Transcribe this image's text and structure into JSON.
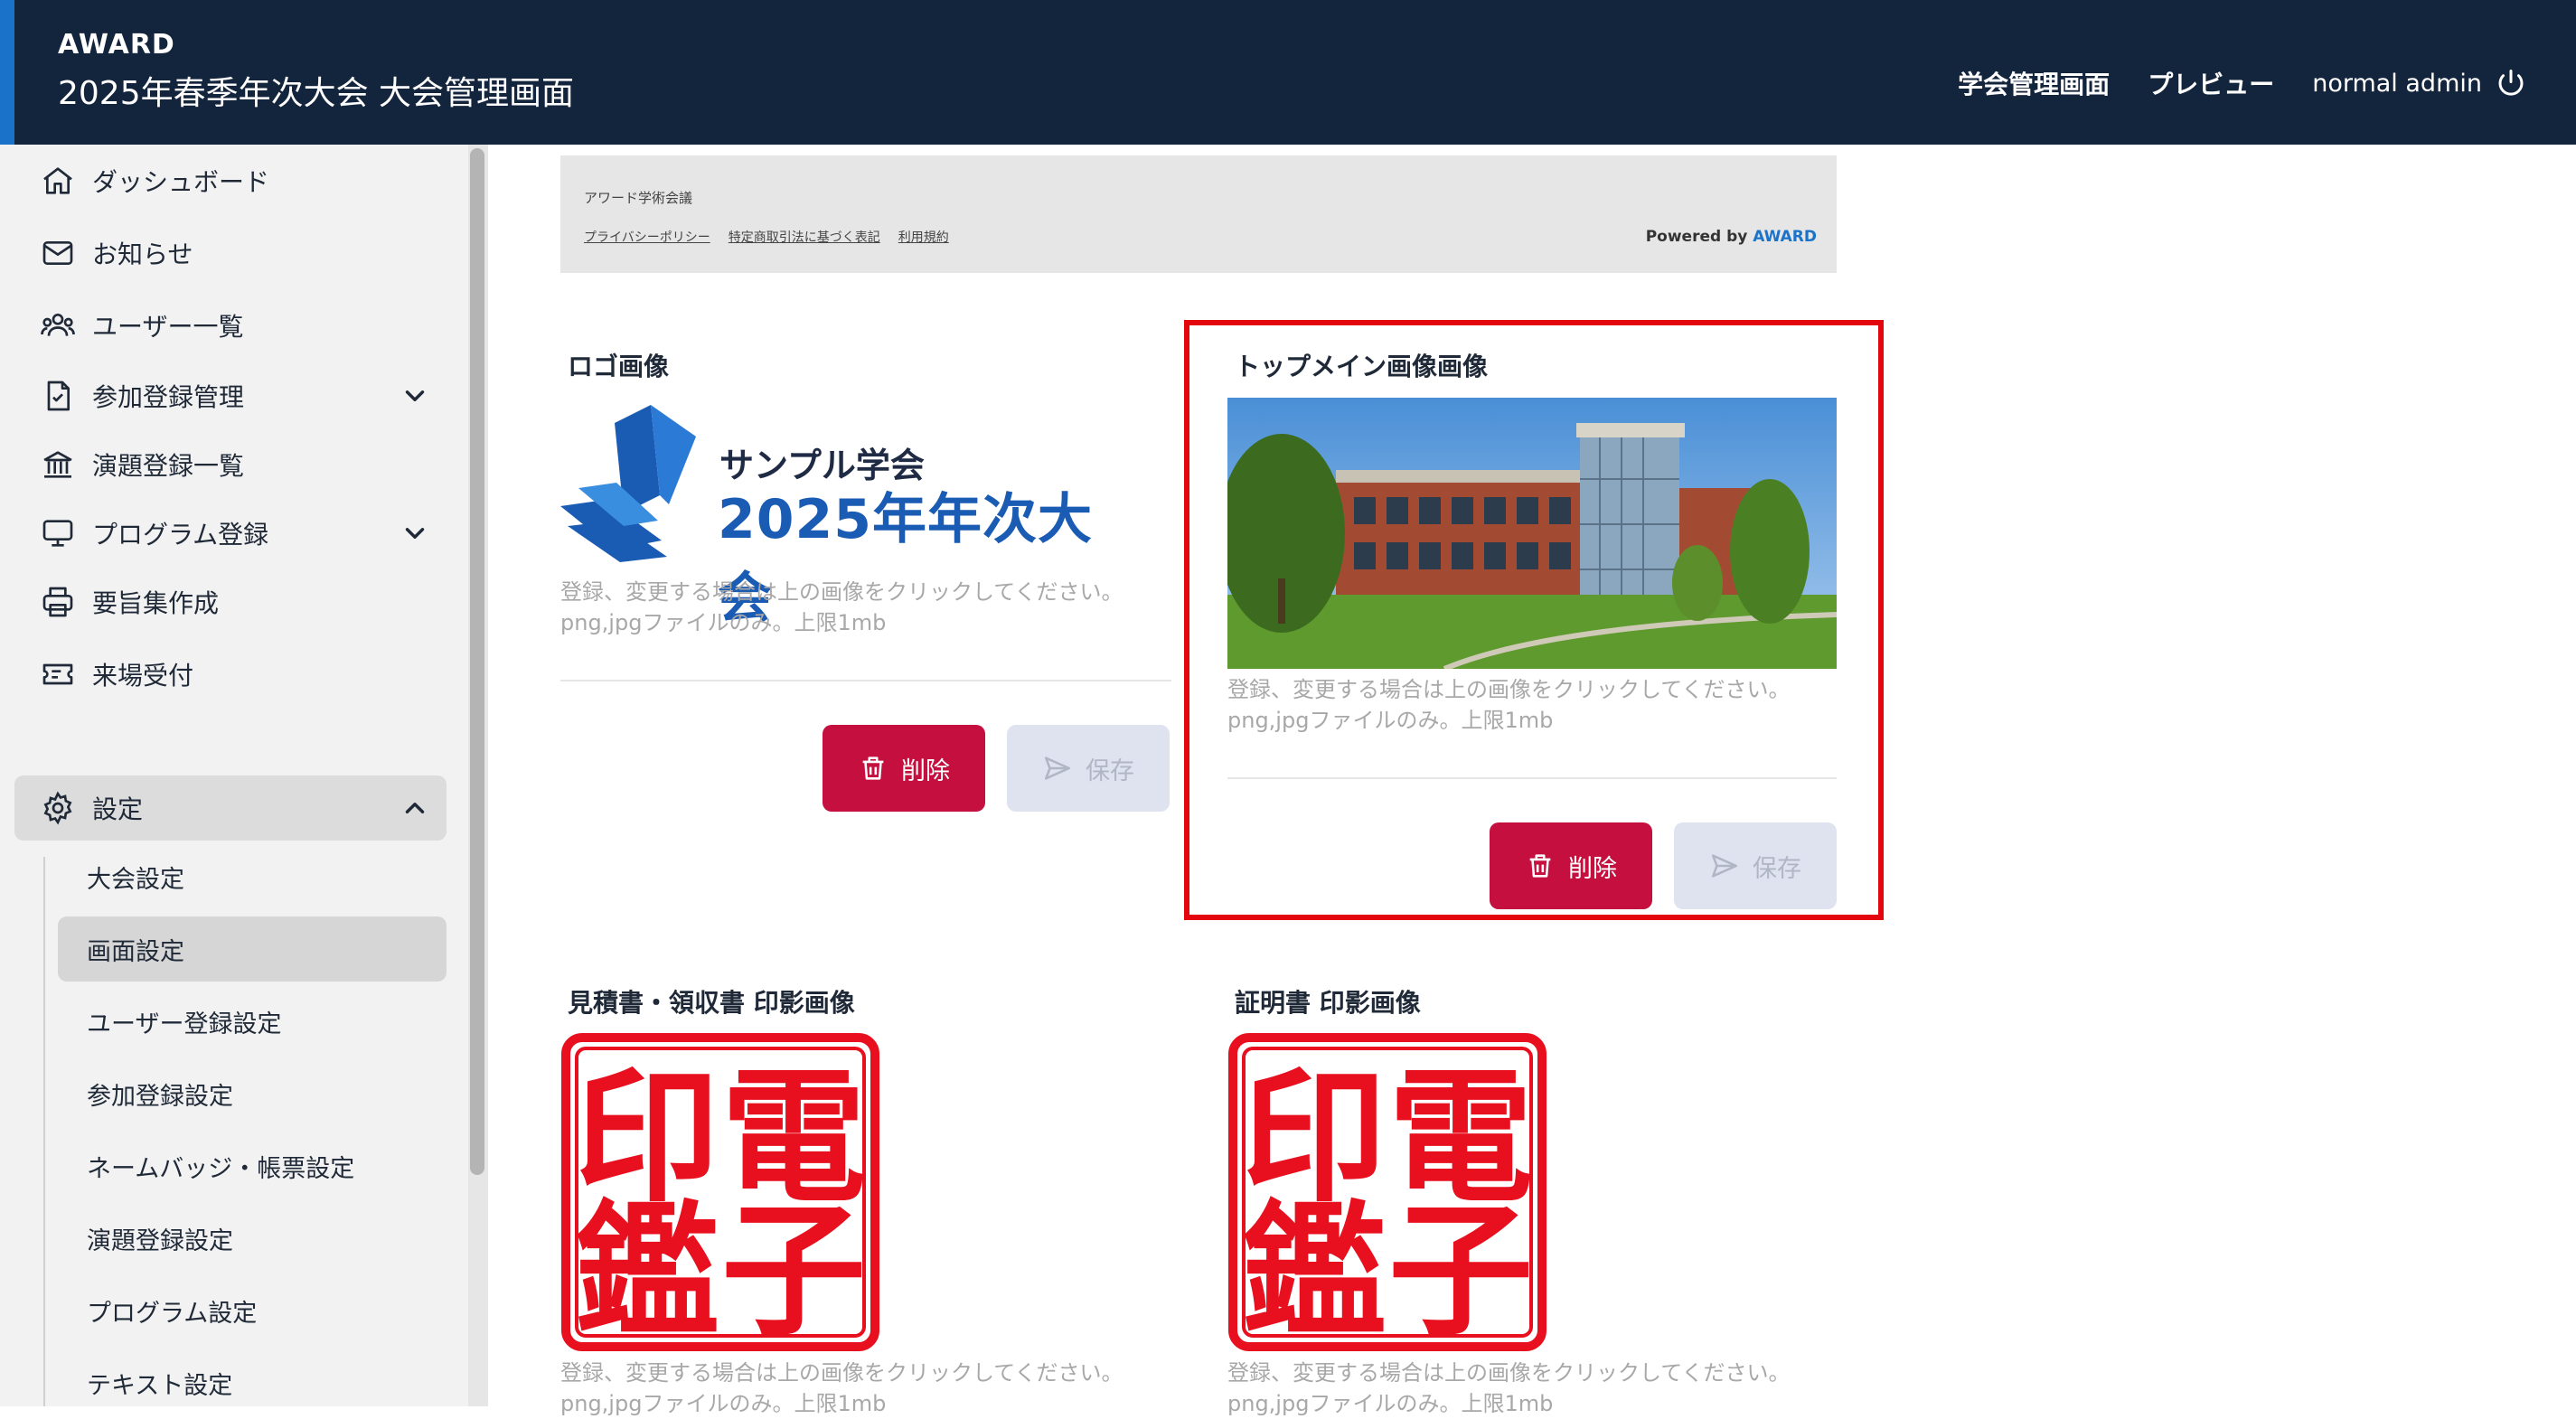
{
  "header": {
    "brand": "AWARD",
    "event_title": "2025年春季年次大会 大会管理画面",
    "nav": [
      "学会管理画面",
      "プレビュー"
    ],
    "user": "normal admin"
  },
  "sidebar": {
    "items": [
      {
        "label": "ダッシュボード",
        "icon": "home-icon"
      },
      {
        "label": "お知らせ",
        "icon": "mail-icon"
      },
      {
        "label": "ユーザー一覧",
        "icon": "users-icon"
      },
      {
        "label": "参加登録管理",
        "icon": "document-check-icon"
      },
      {
        "label": "演題登録一覧",
        "icon": "building-icon"
      },
      {
        "label": "プログラム登録",
        "icon": "monitor-icon"
      },
      {
        "label": "要旨集作成",
        "icon": "printer-icon"
      },
      {
        "label": "来場受付",
        "icon": "ticket-icon"
      }
    ],
    "settings": {
      "label": "設定",
      "sub_items": [
        "大会設定",
        "画面設定",
        "ユーザー登録設定",
        "参加登録設定",
        "ネームバッジ・帳票設定",
        "演題登録設定",
        "プログラム設定",
        "テキスト設定"
      ],
      "active": "画面設定"
    }
  },
  "footer_preview": {
    "org_name": "アワード学術会議",
    "links": [
      "プライバシーポリシー",
      "特定商取引法に基づく表記",
      "利用規約"
    ],
    "powered_by_prefix": "Powered by",
    "powered_by_brand": "AWARD"
  },
  "cards": {
    "logo": {
      "label": "ロゴ画像",
      "logo_line1": "サンプル学会",
      "logo_line2": "2025年年次大会",
      "hint1": "登録、変更する場合は上の画像をクリックしてください。",
      "hint2": "png,jpgファイルのみ。上限1mb",
      "delete": "削除",
      "save": "保存"
    },
    "top_main": {
      "label": "トップメイン画像画像",
      "hint1": "登録、変更する場合は上の画像をクリックしてください。",
      "hint2": "png,jpgファイルのみ。上限1mb",
      "delete": "削除",
      "save": "保存"
    },
    "estimate_seal": {
      "label": "見積書・領収書 印影画像",
      "hint1": "登録、変更する場合は上の画像をクリックしてください。",
      "hint2": "png,jpgファイルのみ。上限1mb"
    },
    "certificate_seal": {
      "label": "証明書 印影画像",
      "hint1": "登録、変更する場合は上の画像をクリックしてください。",
      "hint2": "png,jpgファイルのみ。上限1mb"
    }
  },
  "seal_text": [
    "印",
    "電",
    "鑑",
    "子"
  ],
  "colors": {
    "header_bg": "#13243d",
    "accent": "#1a73c9",
    "delete_button": "#c5103f",
    "highlight": "#e3060f",
    "seal_red": "#e8101e"
  }
}
